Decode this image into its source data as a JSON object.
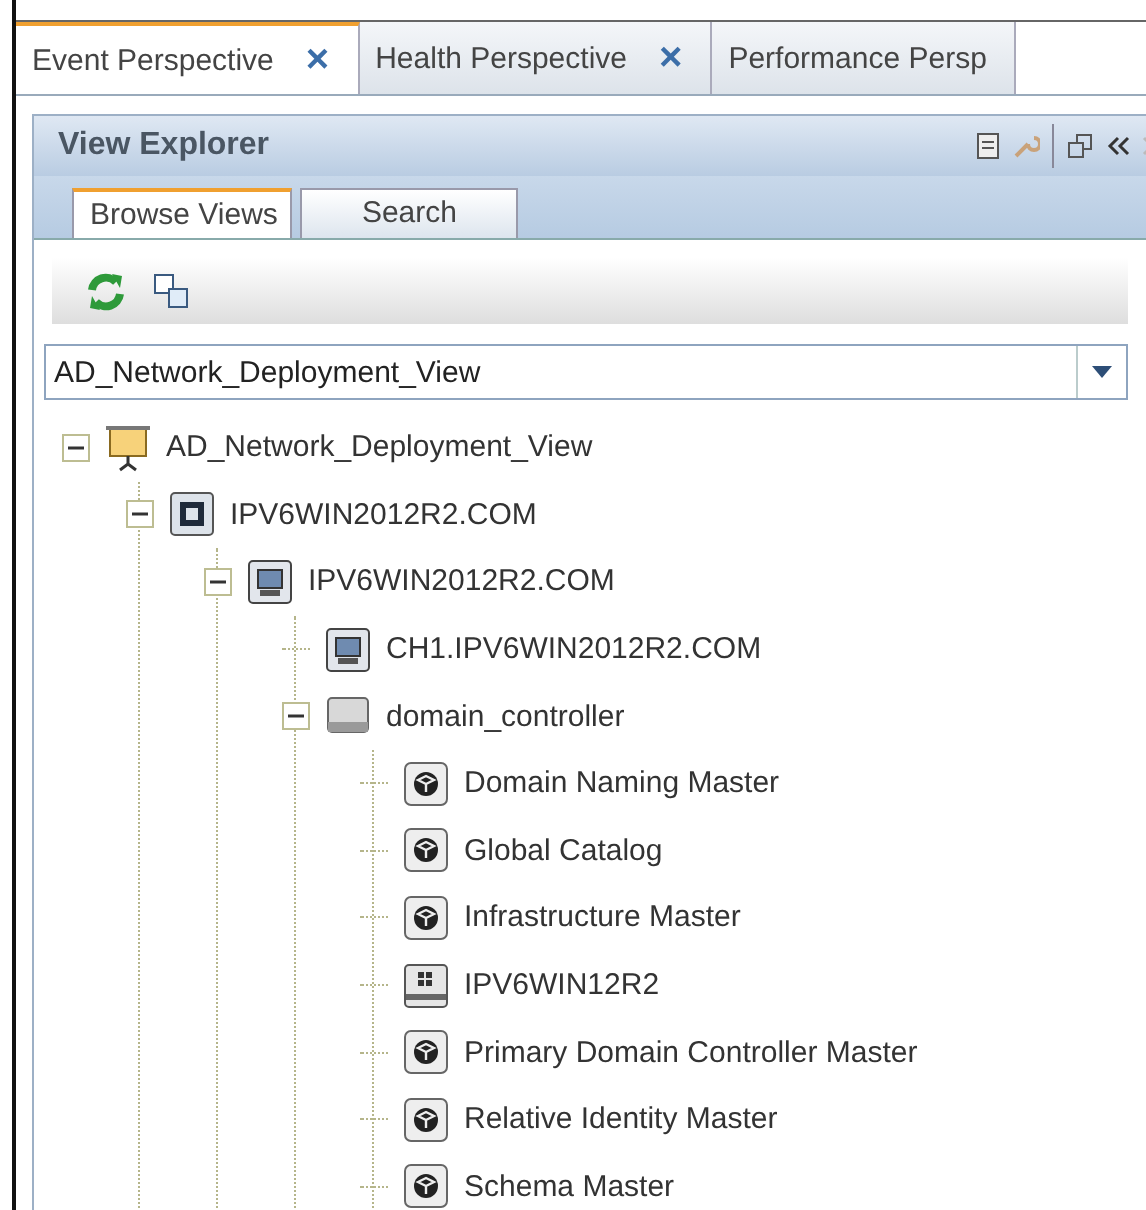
{
  "perspective_tabs": [
    {
      "label": "Event Perspective",
      "close": "×",
      "selected": true
    },
    {
      "label": "Health Perspective",
      "close": "×",
      "selected": false
    },
    {
      "label": "Performance Persp",
      "selected": false
    }
  ],
  "panel": {
    "title": "View Explorer"
  },
  "view_tabs": [
    {
      "label": "Browse Views",
      "selected": true
    },
    {
      "label": "Search",
      "selected": false
    }
  ],
  "view_selector": {
    "value": "AD_Network_Deployment_View"
  },
  "tree": [
    {
      "label": "AD_Network_Deployment_View",
      "kind": "view",
      "expanded": true,
      "children": [
        {
          "label": "IPV6WIN2012R2.COM",
          "kind": "server",
          "expanded": true,
          "children": [
            {
              "label": "IPV6WIN2012R2.COM",
              "kind": "host",
              "expanded": true,
              "children": [
                {
                  "label": "CH1.IPV6WIN2012R2.COM",
                  "kind": "host"
                },
                {
                  "label": "domain_controller",
                  "kind": "cluster",
                  "expanded": true,
                  "children": [
                    {
                      "label": "Domain Naming Master",
                      "kind": "role"
                    },
                    {
                      "label": "Global Catalog",
                      "kind": "role"
                    },
                    {
                      "label": "Infrastructure Master",
                      "kind": "role"
                    },
                    {
                      "label": "IPV6WIN12R2",
                      "kind": "windows"
                    },
                    {
                      "label": "Primary Domain Controller Master",
                      "kind": "role"
                    },
                    {
                      "label": "Relative Identity Master",
                      "kind": "role"
                    },
                    {
                      "label": "Schema Master",
                      "kind": "role"
                    }
                  ]
                }
              ]
            }
          ]
        }
      ]
    }
  ]
}
